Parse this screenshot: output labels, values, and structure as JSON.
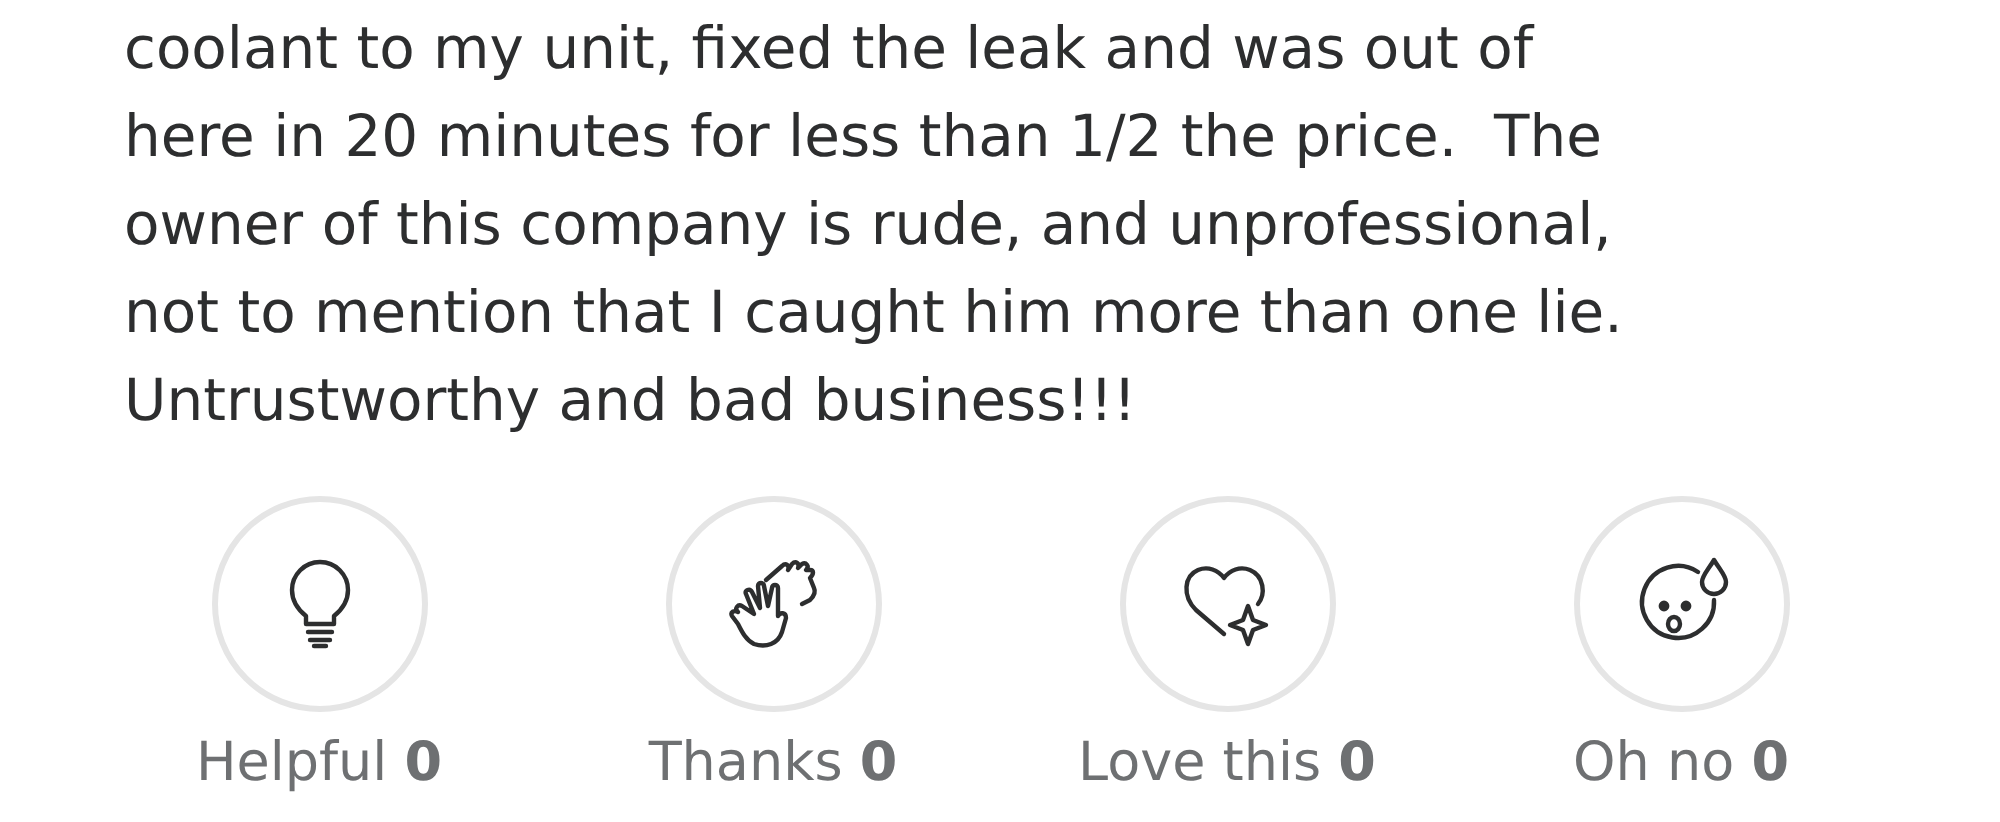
{
  "review": {
    "lines": [
      "coolant to my unit, fixed the leak and was out of",
      "here in 20 minutes for less than 1/2 the price.  The",
      "owner of this company is rude, and unprofessional,",
      "not to mention that I caught him more than one lie.",
      "Untrustworthy and bad business!!!"
    ]
  },
  "reactions": [
    {
      "kind": "bulb",
      "label": "Helpful",
      "count": "0"
    },
    {
      "kind": "hands",
      "label": "Thanks",
      "count": "0"
    },
    {
      "kind": "heart",
      "label": "Love this",
      "count": "0"
    },
    {
      "kind": "face",
      "label": "Oh no",
      "count": "0"
    }
  ]
}
